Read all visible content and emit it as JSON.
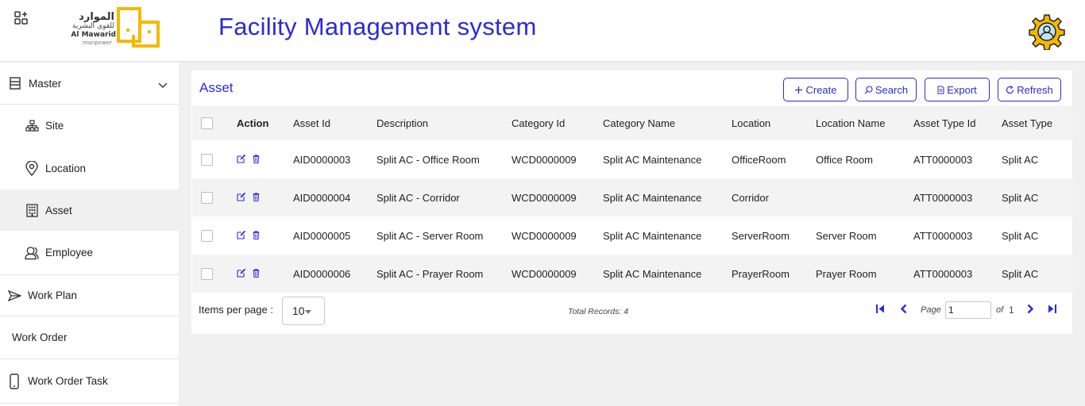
{
  "app": {
    "title": "Facility Management system",
    "logo": {
      "arabic_name": "الموارد",
      "arabic_sub": "للقوى البشرية",
      "english_name": "Al Mawarid",
      "english_sub": "manpower"
    },
    "accent_color": "#2b2bd6",
    "logo_color": "#f5b800"
  },
  "header_icons": {
    "left": "apps-add-icon",
    "right": "settings-user-icon"
  },
  "sidebar": {
    "items": [
      {
        "label": "Master",
        "icon": "list-icon",
        "expanded": true
      },
      {
        "label": "Site",
        "icon": "sitemap-icon"
      },
      {
        "label": "Location",
        "icon": "location-pin-icon"
      },
      {
        "label": "Asset",
        "icon": "building-icon",
        "active": true
      },
      {
        "label": "Employee",
        "icon": "users-icon"
      },
      {
        "label": "Work Plan",
        "icon": "send-icon"
      },
      {
        "label": "Work Order",
        "icon": ""
      },
      {
        "label": "Work Order Task",
        "icon": "mobile-icon"
      }
    ]
  },
  "panel": {
    "title": "Asset",
    "buttons": {
      "create": "Create",
      "search": "Search",
      "export": "Export",
      "refresh": "Refresh"
    }
  },
  "table": {
    "columns": [
      "Action",
      "Asset Id",
      "Description",
      "Category Id",
      "Category Name",
      "Location",
      "Location Name",
      "Asset Type Id",
      "Asset Type"
    ],
    "rows": [
      {
        "asset_id": "AID0000003",
        "description": "Split AC - Office Room",
        "category_id": "WCD0000009",
        "category_name": "Split AC Maintenance",
        "location": "OfficeRoom",
        "location_name": "Office Room",
        "asset_type_id": "ATT0000003",
        "asset_type": "Split AC"
      },
      {
        "asset_id": "AID0000004",
        "description": "Split AC - Corridor",
        "category_id": "WCD0000009",
        "category_name": "Split AC Maintenance",
        "location": "Corridor",
        "location_name": "",
        "asset_type_id": "ATT0000003",
        "asset_type": "Split AC"
      },
      {
        "asset_id": "AID0000005",
        "description": "Split AC - Server Room",
        "category_id": "WCD0000009",
        "category_name": "Split AC Maintenance",
        "location": "ServerRoom",
        "location_name": "Server Room",
        "asset_type_id": "ATT0000003",
        "asset_type": "Split AC"
      },
      {
        "asset_id": "AID0000006",
        "description": "Split AC - Prayer Room",
        "category_id": "WCD0000009",
        "category_name": "Split AC Maintenance",
        "location": "PrayerRoom",
        "location_name": "Prayer Room",
        "asset_type_id": "ATT0000003",
        "asset_type": "Split AC"
      }
    ]
  },
  "pager": {
    "items_per_page_label": "Items per page :",
    "items_per_page": "10",
    "total_records": "Total Records: 4",
    "page_label": "Page",
    "page_value": "1",
    "of_label": "of",
    "total_pages": "1"
  }
}
